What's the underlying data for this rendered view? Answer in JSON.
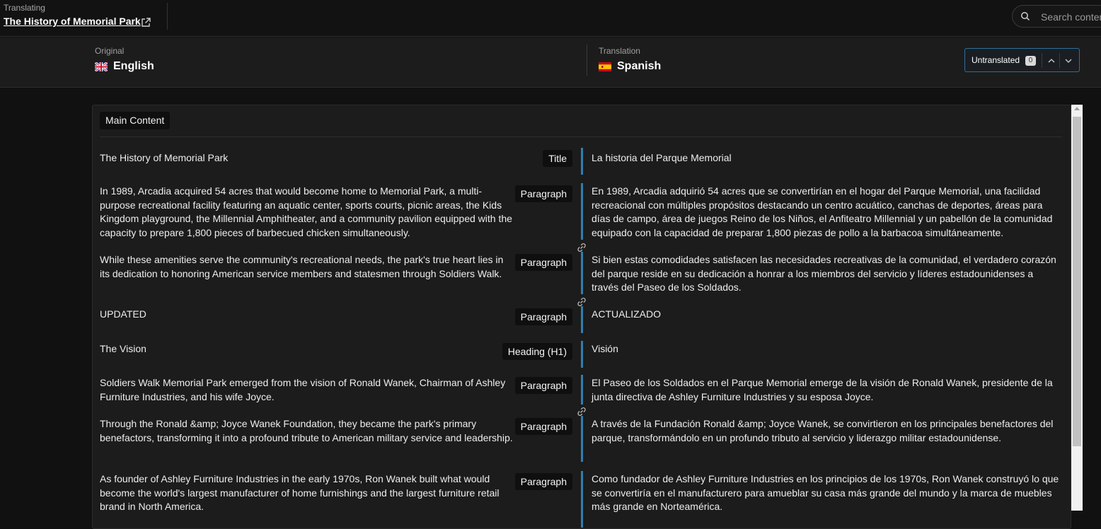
{
  "topbar": {
    "label": "Translating",
    "title": "The History of Memorial Park",
    "external_link_icon": "external-link-icon",
    "search": {
      "placeholder": "Search content",
      "value": ""
    }
  },
  "languages": {
    "original": {
      "label": "Original",
      "name": "English",
      "flag": "uk-flag"
    },
    "translation": {
      "label": "Translation",
      "name": "Spanish",
      "flag": "spain-flag"
    }
  },
  "untranslated": {
    "label": "Untranslated",
    "count": "0"
  },
  "section": {
    "label": "Main Content"
  },
  "rows": [
    {
      "tag": "Title",
      "source": "The History of Memorial Park",
      "target": "La historia del Parque Memorial"
    },
    {
      "tag": "Paragraph",
      "source": "In 1989, Arcadia acquired 54 acres that would become home to Memorial Park, a multi-purpose recreational facility featuring an aquatic center, sports courts, picnic areas, the Kids Kingdom playground, the Millennial Amphitheater, and a community pavilion equipped with the capacity to prepare 1,800 pieces of barbecued chicken simultaneously.",
      "target": "En 1989, Arcadia adquirió 54 acres que se convertirían en el hogar del Parque Memorial, una facilidad recreacional con múltiples propósitos destacando un centro acuático, canchas de deportes, áreas para días de campo, área de juegos Reino de los Niños, el Anfiteatro Millennial y un pabellón de la comunidad equipado con la capacidad de preparar 1,800 piezas de pollo a la barbacoa simultáneamente."
    },
    {
      "tag": "Paragraph",
      "source": "While these amenities serve the community's recreational needs, the park's true heart lies in its dedication to honoring American service members and statesmen through Soldiers Walk.",
      "target": "Si bien estas comodidades satisfacen las necesidades recreativas de la comunidad, el verdadero corazón del parque reside en su dedicación a honrar a los miembros del servicio y líderes estadounidenses a través del Paseo de los Soldados."
    },
    {
      "tag": "Paragraph",
      "source": "UPDATED",
      "target": "ACTUALIZADO"
    },
    {
      "tag": "Heading (H1)",
      "source": "The Vision",
      "target": "Visión"
    },
    {
      "tag": "Paragraph",
      "source": "Soldiers Walk Memorial Park emerged from the vision of Ronald Wanek, Chairman of Ashley Furniture Industries, and his wife Joyce.",
      "target": "El Paseo de los Soldados en el Parque Memorial emerge de la visión de Ronald Wanek, presidente de la junta directiva de Ashley Furniture Industries y su esposa Joyce."
    },
    {
      "tag": "Paragraph",
      "source": "Through the Ronald &amp; Joyce Wanek Foundation, they became the park's primary benefactors, transforming it into a profound tribute to American military service and leadership.",
      "target": "A través de la Fundación Ronald &amp; Joyce Wanek, se convirtieron en los principales benefactores del parque, transformándolo en un profundo tributo al servicio y liderazgo militar estadounidense."
    },
    {
      "tag": "Paragraph",
      "source": "As founder of Ashley Furniture Industries in the early 1970s, Ron Wanek built what would become the world's largest manufacturer of home furnishings and the largest furniture retail brand in North America.",
      "target": "Como fundador de Ashley Furniture Industries en los principios de los 1970s, Ron Wanek construyó lo que se convertiría en el manufacturero para amueblar su casa más grande del mundo y la marca de muebles más grande en Norteamérica."
    }
  ],
  "colors": {
    "accent": "#2f7fb0",
    "background": "#111111",
    "panel": "#1c1c1c"
  }
}
